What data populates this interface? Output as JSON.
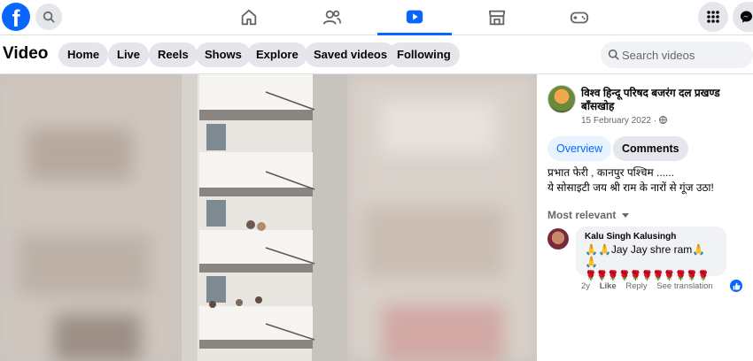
{
  "topbar": {
    "logo_letter": "f",
    "nav": [
      {
        "name": "home",
        "active": false
      },
      {
        "name": "friends",
        "active": false
      },
      {
        "name": "video",
        "active": true
      },
      {
        "name": "marketplace",
        "active": false
      },
      {
        "name": "gaming",
        "active": false
      }
    ],
    "accent_color": "#0866ff"
  },
  "subbar": {
    "title": "Video",
    "chips": [
      "Home",
      "Live",
      "Reels",
      "Shows",
      "Explore",
      "Saved videos",
      "Following"
    ],
    "search_placeholder": "Search videos"
  },
  "post": {
    "page_name": "विश्व हिन्दू परिषद बजरंग दल प्रखण्ड बाँसखोह",
    "date": "15 February 2022 · ",
    "audience_icon": "globe-icon",
    "tabs": [
      "Overview",
      "Comments"
    ],
    "description_line1": "प्रभात फेरी , कानपुर पश्चिम ......",
    "description_line2": "ये सोसाइटी जय श्री राम के नारों से गूंज उठा!",
    "sort_label": "Most relevant"
  },
  "comment": {
    "author": "Kalu Singh Kalusingh",
    "text": "🙏🙏Jay Jay shre ram🙏🙏",
    "roses": "🌹🌹🌹🌹🌹🌹🌹🌹🌹🌹🌹",
    "age": "2y",
    "like": "Like",
    "reply": "Reply",
    "see_translation": "See translation"
  }
}
